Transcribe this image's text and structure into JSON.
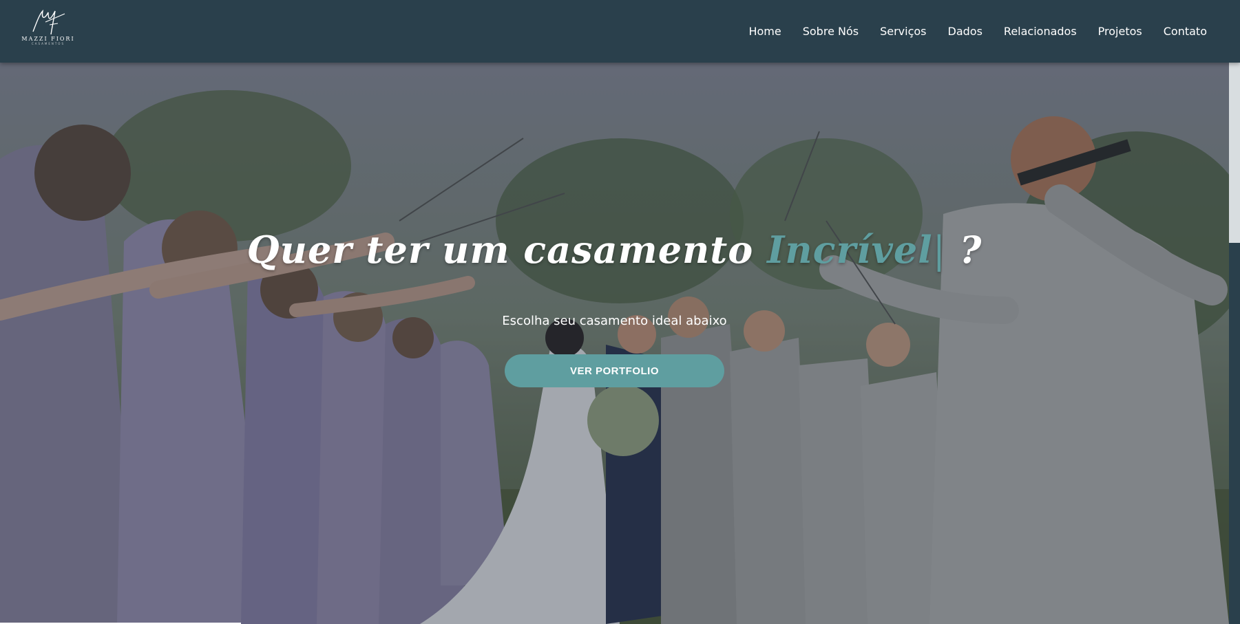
{
  "brand": {
    "name": "MAZZI FIORI",
    "tagline": "CASAMENTOS",
    "logo_icon": "mf-monogram-icon"
  },
  "nav": {
    "items": [
      {
        "label": "Home"
      },
      {
        "label": "Sobre Nós"
      },
      {
        "label": "Serviços"
      },
      {
        "label": "Dados"
      },
      {
        "label": "Relacionados"
      },
      {
        "label": "Projetos"
      },
      {
        "label": "Contato"
      }
    ]
  },
  "hero": {
    "headline_prefix": "Quer ter um casamento ",
    "headline_highlight": "Incrível",
    "headline_cursor": "|",
    "headline_suffix": " ?",
    "subtitle": "Escolha seu casamento ideal abaixo",
    "cta_label": "VER PORTFOLIO",
    "image": "wedding-couple-kiss-sparklers-photo"
  },
  "colors": {
    "navbar": "#2a404c",
    "accent": "#5f9ea0",
    "text": "#ffffff"
  }
}
